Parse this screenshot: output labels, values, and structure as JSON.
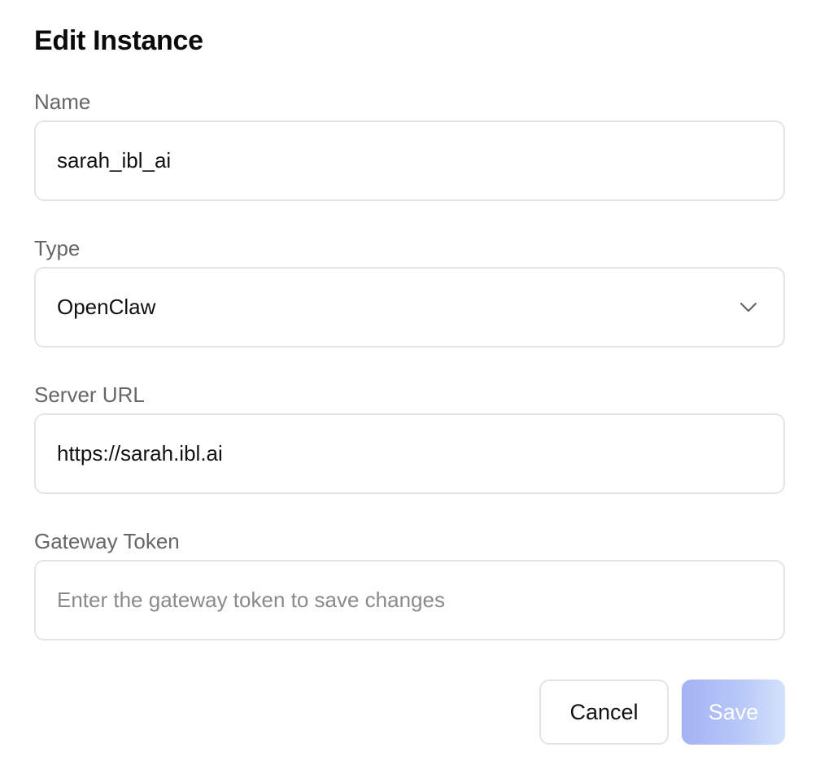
{
  "dialog": {
    "title": "Edit Instance"
  },
  "fields": {
    "name": {
      "label": "Name",
      "value": "sarah_ibl_ai"
    },
    "type": {
      "label": "Type",
      "value": "OpenClaw"
    },
    "server_url": {
      "label": "Server URL",
      "value": "https://sarah.ibl.ai"
    },
    "gateway_token": {
      "label": "Gateway Token",
      "value": "",
      "placeholder": "Enter the gateway token to save changes"
    }
  },
  "actions": {
    "cancel_label": "Cancel",
    "save_label": "Save"
  },
  "icons": {
    "type_select": "chevron-down-icon"
  },
  "colors": {
    "save_gradient_start": "#a4b2f4",
    "save_gradient_end": "#d3e2fb",
    "border": "#e5e5e5",
    "label": "#666666"
  }
}
